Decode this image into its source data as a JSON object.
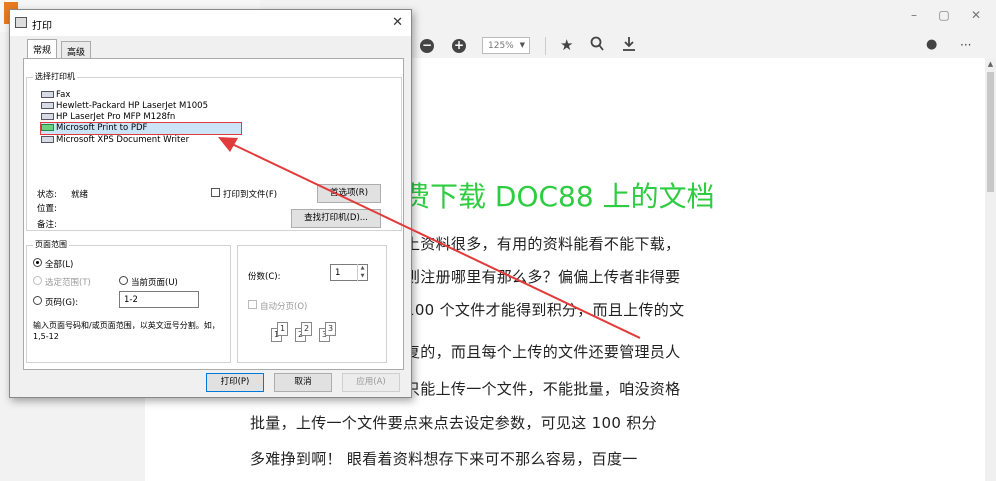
{
  "browser": {
    "window_controls": {
      "minimize": "–",
      "restore": "▢",
      "close": "✕"
    },
    "toolbar": {
      "zoom_out": "−",
      "zoom_in": "+",
      "zoom_value": "125%",
      "profile": "●",
      "more": "···"
    }
  },
  "document": {
    "heading": "费下载 DOC88 上的文档",
    "lines": [
      "上资料很多，有用的资料能看不能下载，",
      "则注册哪里有那么多？偏偏上传者非得要",
      "100 个文件才能得到积分，而且上传的文",
      "复的，而且每个上传的文件还要管理员人",
      "只能上传一个文件，不能批量，咱没资格",
      "批量，上传一个文件要点来点去设定参数，可见这 100 积分",
      "多难挣到啊！   眼看着资料想存下来可不那么容易，百度一"
    ]
  },
  "print_dialog": {
    "title": "打印",
    "close": "✕",
    "tabs": [
      "常规",
      "高级"
    ],
    "select_printer_label": "选择打印机",
    "printers": [
      "Fax",
      "Hewlett-Packard HP LaserJet M1005",
      "HP LaserJet Pro MFP M128fn",
      "Microsoft Print to PDF",
      "Microsoft XPS Document Writer"
    ],
    "selected_printer_index": 3,
    "status_label": "状态:",
    "status_value": "就绪",
    "location_label": "位置:",
    "comment_label": "备注:",
    "print_to_file": "打印到文件(F)",
    "preferences_button": "首选项(R)",
    "find_printer_button": "查找打印机(D)...",
    "page_range": {
      "label": "页面范围",
      "all": "全部(L)",
      "selection": "选定范围(T)",
      "current_page": "当前页面(U)",
      "pages": "页码(G):",
      "pages_value": "1-2",
      "hint": "输入页面号码和/或页面范围，以英文逗号分割。如，1,5-12"
    },
    "copies_label": "份数(C):",
    "copies_value": "1",
    "collate_label": "自动分页(O)",
    "buttons": {
      "print": "打印(P)",
      "cancel": "取消",
      "apply": "应用(A)"
    }
  },
  "colors": {
    "heading_green": "#2ecc40",
    "annotation_red": "#e23b3b",
    "dialog_accent": "#0078d7"
  }
}
